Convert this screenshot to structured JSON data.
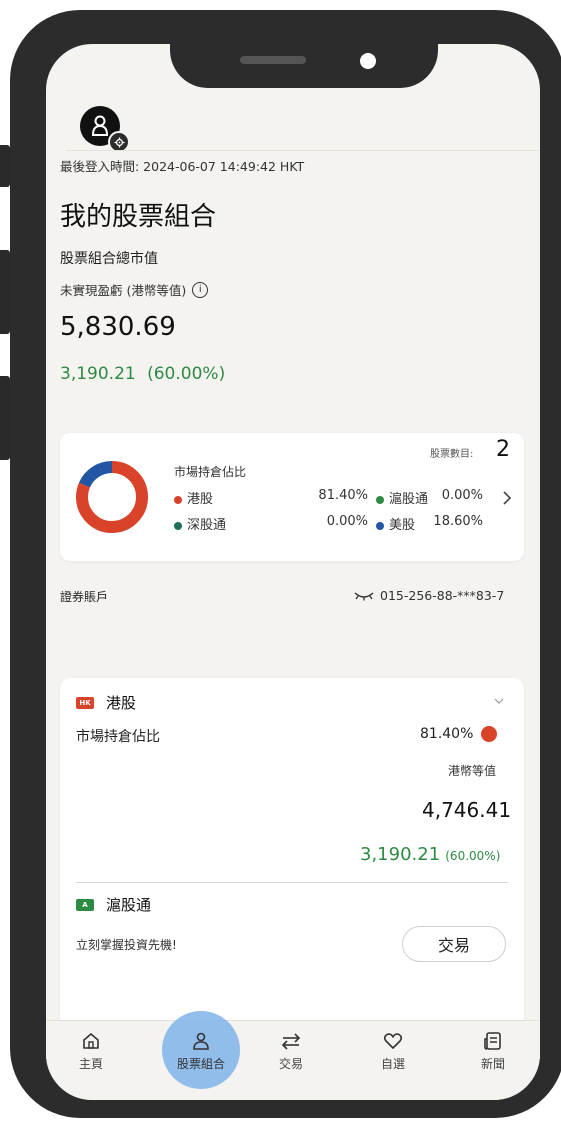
{
  "status": {
    "last_login": "最後登入時間: 2024-06-07 14:49:42 HKT"
  },
  "portfolio": {
    "title": "我的股票組合",
    "total_label": "股票組合總市值",
    "unrealized_label": "未實現盈虧 (港幣等值)",
    "total_value": "5,830.69",
    "pnl_value": "3,190.21",
    "pnl_pct": "(60.00%)"
  },
  "summary_card": {
    "stock_count_label": "股票數目:",
    "stock_count": "2",
    "allocation_label": "市場持倉佔比",
    "markets": [
      {
        "name": "港股",
        "pct": "81.40%",
        "color": "#d9432a",
        "value": 81.4
      },
      {
        "name": "滬股通",
        "pct": "0.00%",
        "color": "#2e8b44",
        "value": 0
      },
      {
        "name": "深股通",
        "pct": "0.00%",
        "color": "#1f6e5a",
        "value": 0
      },
      {
        "name": "美股",
        "pct": "18.60%",
        "color": "#2255a4",
        "value": 18.6
      }
    ]
  },
  "account": {
    "label": "證券賬戶",
    "number": "015-256-88-***83-7"
  },
  "hk_section": {
    "tag": "HK",
    "tag_color": "#d9432a",
    "title": "港股",
    "allocation_label": "市場持倉佔比",
    "allocation_pct": "81.40%",
    "currency_label": "港幣等值",
    "market_value": "4,746.41",
    "pnl_value": "3,190.21",
    "pnl_pct": "(60.00%)"
  },
  "sh_section": {
    "tag": "A",
    "tag_color": "#2e8b44",
    "title": "滬股通",
    "promo": "立刻掌握投資先機!",
    "trade_button": "交易"
  },
  "bottom_nav": {
    "items": [
      {
        "label": "主頁",
        "icon": "home-icon"
      },
      {
        "label": "股票組合",
        "icon": "person-icon"
      },
      {
        "label": "交易",
        "icon": "swap-arrows-icon"
      },
      {
        "label": "自選",
        "icon": "heart-icon"
      },
      {
        "label": "新聞",
        "icon": "news-icon"
      }
    ]
  }
}
